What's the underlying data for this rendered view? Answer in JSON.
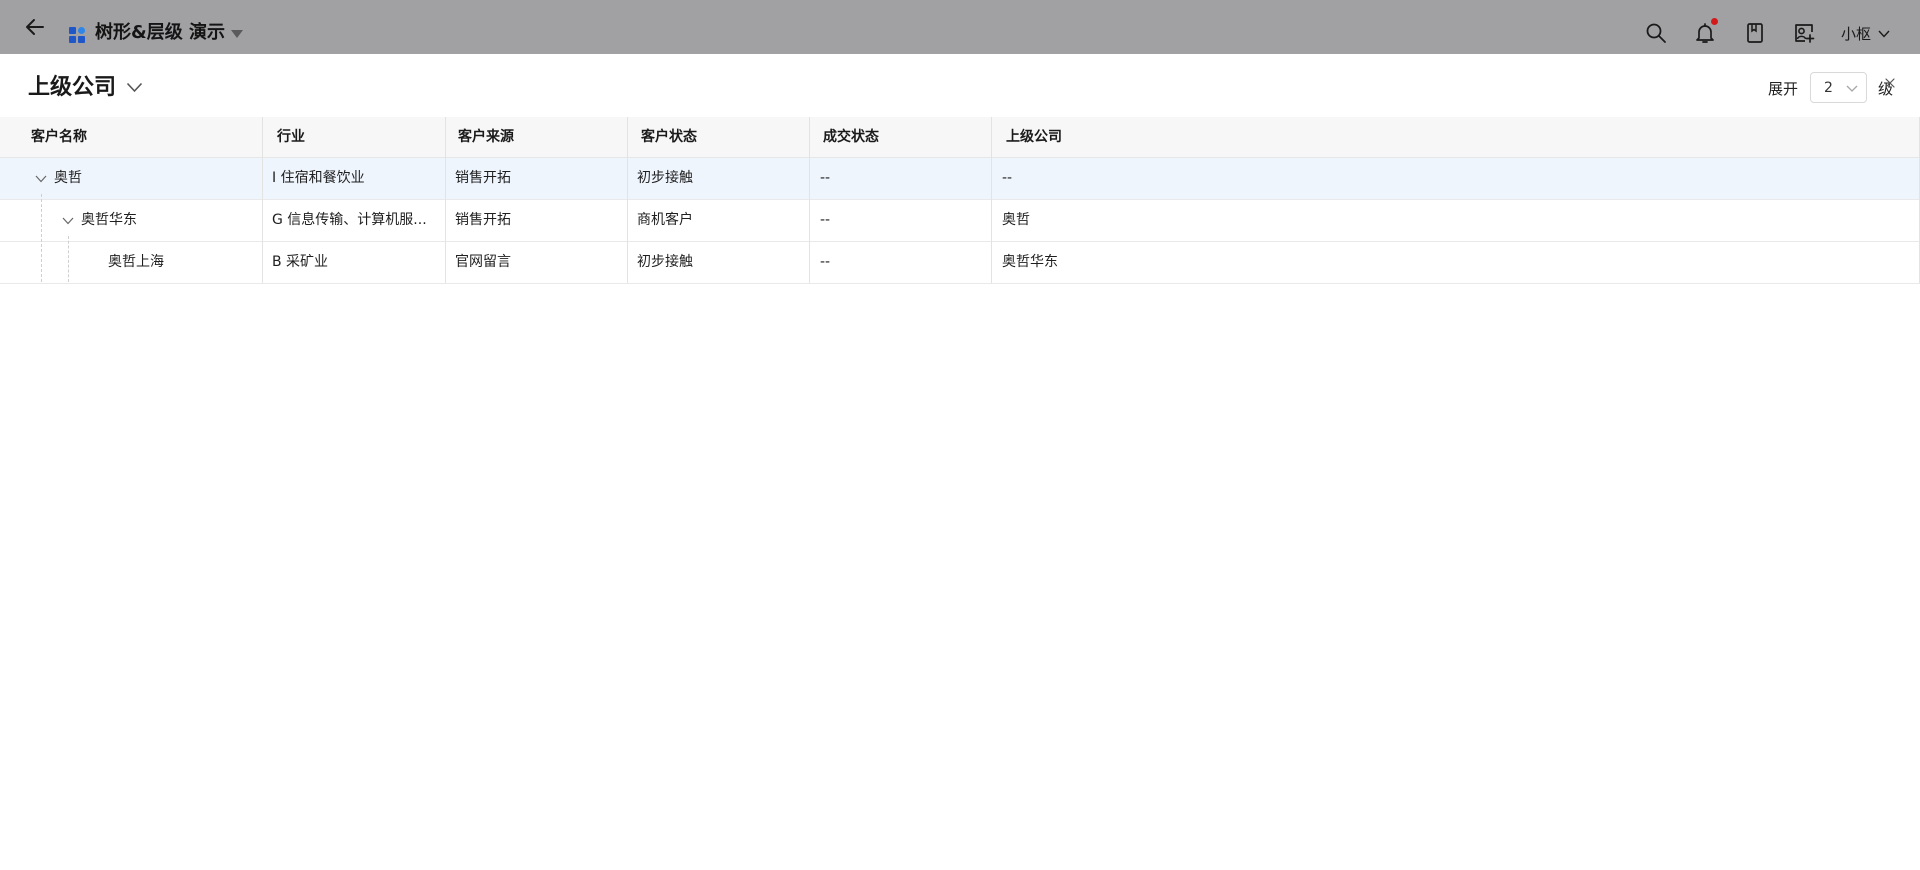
{
  "app": {
    "title": "树形&层级 演示",
    "user_name": "小枢",
    "notification_badge_color": "#d21a1a",
    "app_icon_color": "#1f56c8"
  },
  "page": {
    "title": "上级公司",
    "expand_label": "展开",
    "level_value": "2",
    "level_unit": "级"
  },
  "table": {
    "columns": [
      "客户名称",
      "行业",
      "客户来源",
      "客户状态",
      "成交状态",
      "上级公司"
    ],
    "rows": [
      {
        "level": 0,
        "expandable": true,
        "selected": true,
        "name": "奥哲",
        "industry": "I 住宿和餐饮业",
        "source": "销售开拓",
        "status": "初步接触",
        "deal_status": "--",
        "parent": "--"
      },
      {
        "level": 1,
        "expandable": true,
        "selected": false,
        "name": "奥哲华东",
        "industry": "G 信息传输、计算机服...",
        "source": "销售开拓",
        "status": "商机客户",
        "deal_status": "--",
        "parent": "奥哲"
      },
      {
        "level": 2,
        "expandable": false,
        "selected": false,
        "name": "奥哲上海",
        "industry": "B 采矿业",
        "source": "官网留言",
        "status": "初步接触",
        "deal_status": "--",
        "parent": "奥哲华东"
      }
    ]
  },
  "icons": {
    "back": "arrow-left-icon",
    "app": "grid-apps-icon",
    "search": "search-icon",
    "notifications": "bell-icon",
    "book": "book-icon",
    "contacts": "contact-card-icon"
  }
}
